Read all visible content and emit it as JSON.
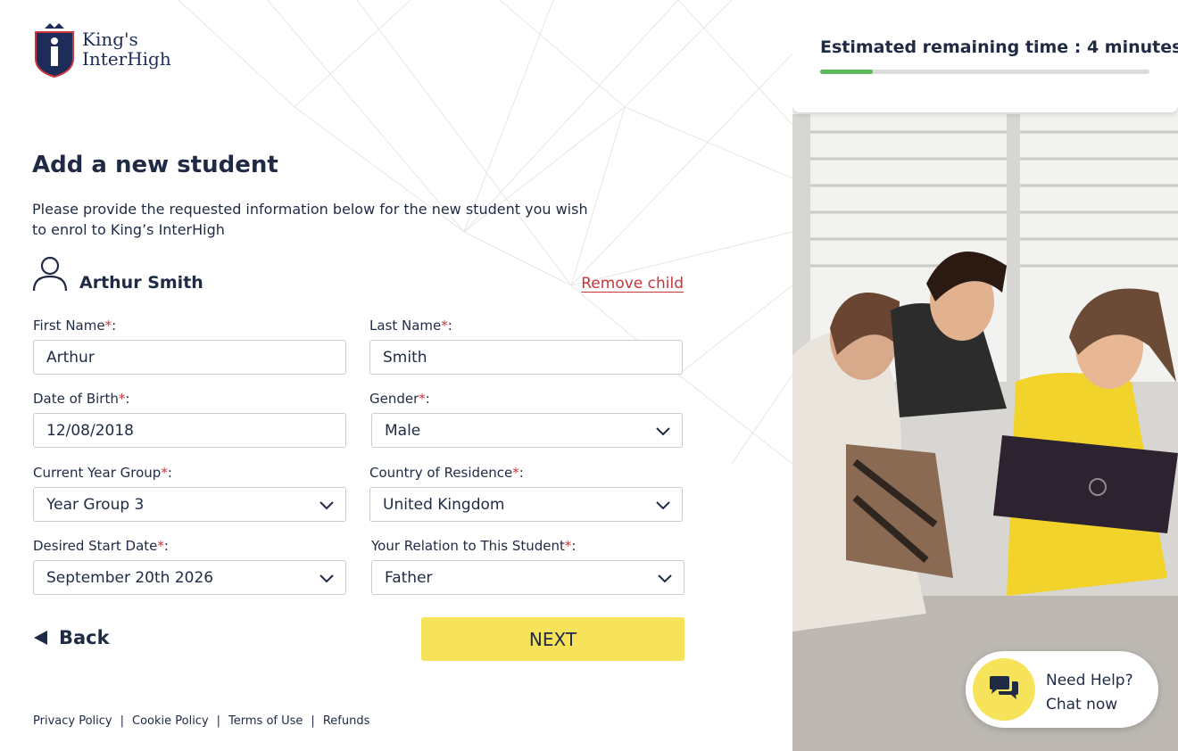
{
  "logo": {
    "line1": "King's",
    "line2": "InterHigh"
  },
  "page": {
    "title": "Add a new student",
    "intro": "Please provide the requested information below for the new student you wish to enrol to King’s InterHigh"
  },
  "student": {
    "name": "Arthur Smith",
    "remove_label": "Remove child"
  },
  "form": {
    "first_name": {
      "label": "First Name",
      "value": "Arthur"
    },
    "last_name": {
      "label": "Last Name",
      "value": "Smith"
    },
    "dob": {
      "label": "Date of Birth",
      "value": "12/08/2018"
    },
    "gender": {
      "label": "Gender",
      "value": "Male"
    },
    "year_group": {
      "label": "Current Year Group",
      "value": "Year Group 3"
    },
    "country": {
      "label": "Country of Residence",
      "value": "United Kingdom"
    },
    "start_date": {
      "label": "Desired Start Date",
      "value": "September 20th 2026"
    },
    "relation": {
      "label": "Your Relation to This Student",
      "value": "Father"
    },
    "required_mark": "*",
    "colon": ":"
  },
  "actions": {
    "back_label": "Back",
    "next_label": "NEXT"
  },
  "footer": {
    "links": [
      "Privacy Policy",
      "Cookie Policy",
      "Terms of Use",
      "Refunds"
    ],
    "separator": "|"
  },
  "progress": {
    "text": "Estimated remaining time : 4 minutes",
    "fraction": 0.16
  },
  "help": {
    "line1": "Need Help?",
    "line2": "Chat now"
  },
  "colors": {
    "accent_yellow": "#f7e35a",
    "required_red": "#c8363b",
    "navy": "#1f2a44",
    "progress_green": "#5cb85c"
  },
  "icons": [
    "user-icon",
    "chevron-down-icon",
    "back-arrow-icon",
    "chat-icon",
    "shield-logo-icon"
  ]
}
